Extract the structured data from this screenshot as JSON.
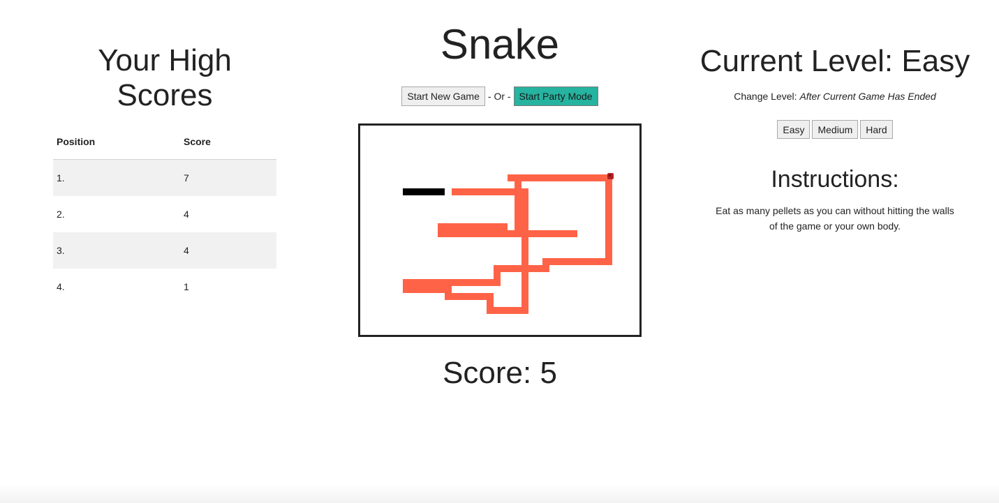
{
  "high_scores": {
    "title": "Your High Scores",
    "columns": [
      "Position",
      "Score"
    ],
    "rows": [
      {
        "position": "1.",
        "score": "7"
      },
      {
        "position": "2.",
        "score": "4"
      },
      {
        "position": "3.",
        "score": "4"
      },
      {
        "position": "4.",
        "score": "1"
      }
    ]
  },
  "game": {
    "title": "Snake",
    "start_button": "Start New Game",
    "separator": "- Or -",
    "party_button": "Start Party Mode",
    "score_text": "Score: 5",
    "colors": {
      "snake": "#ff6347",
      "enemy": "#000000",
      "pellet": "#b22222",
      "party_button": "#26b3a0"
    }
  },
  "level": {
    "title": "Current Level: Easy",
    "change_label": "Change Level:",
    "change_note": "After Current Game Has Ended",
    "options": [
      "Easy",
      "Medium",
      "Hard"
    ]
  },
  "instructions": {
    "title": "Instructions:",
    "text": "Eat as many pellets as you can without hitting the walls of the game or your own body."
  }
}
